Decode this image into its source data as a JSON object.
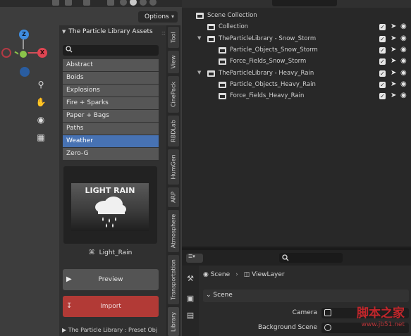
{
  "viewport": {
    "options_label": "Options",
    "gizmo": {
      "z": "Z",
      "x": "X"
    },
    "tools": [
      "zoom-icon",
      "hand-icon",
      "camera-icon",
      "grid-icon"
    ]
  },
  "panel": {
    "header": "The Particle Library Assets",
    "categories": [
      {
        "label": "Abstract"
      },
      {
        "label": "Boids"
      },
      {
        "label": "Explosions"
      },
      {
        "label": "Fire + Sparks"
      },
      {
        "label": "Paper + Bags"
      },
      {
        "label": "Paths"
      },
      {
        "label": "Weather"
      },
      {
        "label": "Zero-G"
      }
    ],
    "selected_category": "Weather",
    "preview_title": "LIGHT RAIN",
    "item_name": "Light_Rain",
    "preview_button": "Preview",
    "import_button": "Import",
    "subpanel": "The Particle Library : Preset Obj"
  },
  "tabs": [
    {
      "label": "Tool"
    },
    {
      "label": "View"
    },
    {
      "label": "CinePack"
    },
    {
      "label": "RBDLab"
    },
    {
      "label": "HumGen"
    },
    {
      "label": "ARP"
    },
    {
      "label": "Atmosphere"
    },
    {
      "label": "Transportation"
    },
    {
      "label": "Library"
    }
  ],
  "outliner": {
    "rows": [
      {
        "label": "Scene Collection"
      },
      {
        "label": "Collection"
      },
      {
        "label": "TheParticleLibrary - Snow_Storm"
      },
      {
        "label": "Particle_Objects_Snow_Storm"
      },
      {
        "label": "Force_Fields_Snow_Storm"
      },
      {
        "label": "TheParticleLibrary - Heavy_Rain"
      },
      {
        "label": "Particle_Objects_Heavy_Rain"
      },
      {
        "label": "Force_Fields_Heavy_Rain"
      }
    ]
  },
  "properties": {
    "breadcrumb": {
      "scene": "Scene",
      "view_layer": "ViewLayer"
    },
    "section": "Scene",
    "rows": [
      {
        "label": "Camera"
      },
      {
        "label": "Background Scene"
      }
    ]
  },
  "watermark": {
    "title": "脚本之家",
    "url": "www.jb51.net"
  },
  "colors": {
    "accent": "#4772b3",
    "import": "#b23a36",
    "x_axis": "#e04552",
    "y_axis": "#8bc34a",
    "z_axis": "#3f8de0"
  }
}
